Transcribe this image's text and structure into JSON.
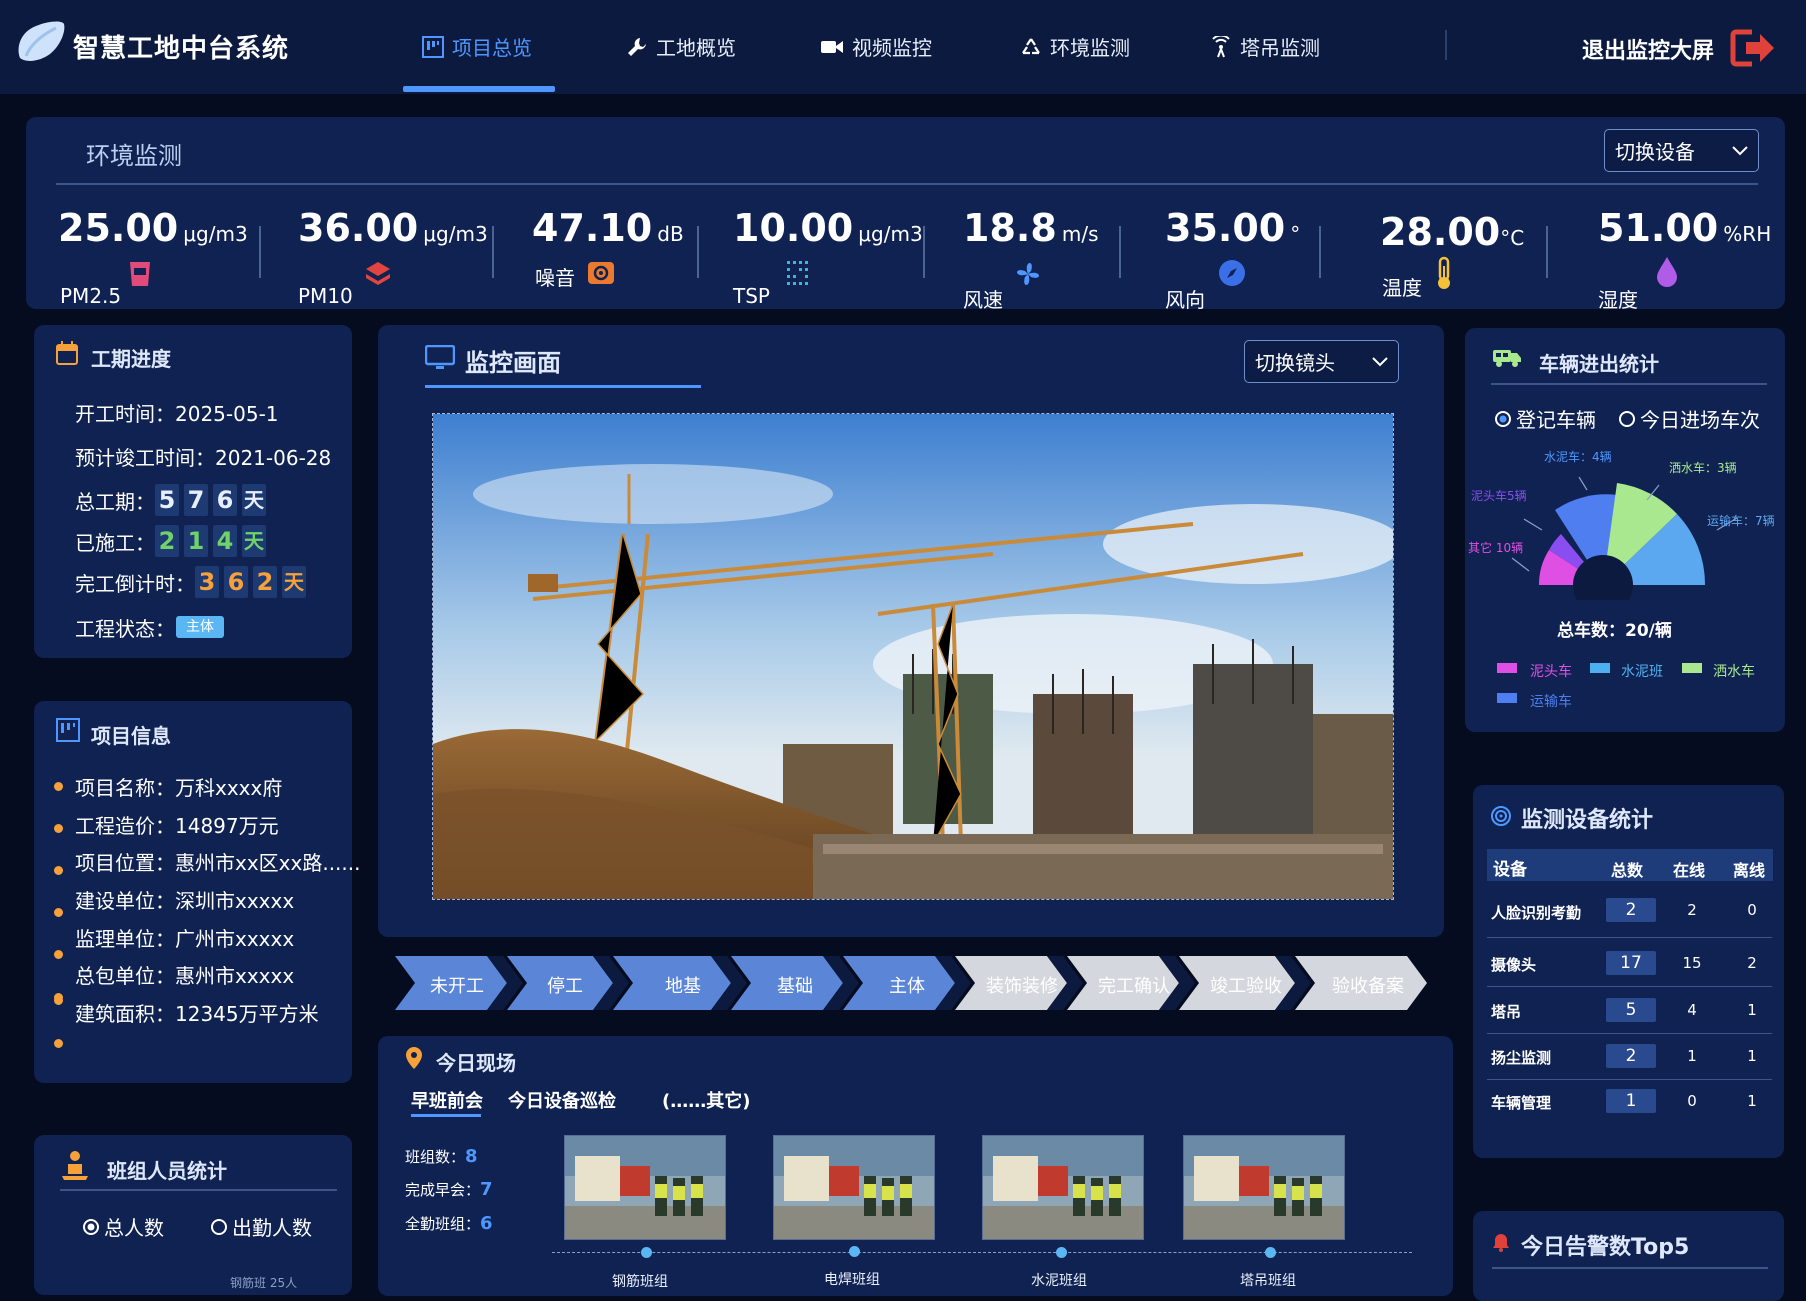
{
  "header": {
    "brand": "智慧工地中台系统",
    "nav": [
      {
        "label": "项目总览",
        "icon": "dashboard-icon",
        "active": true
      },
      {
        "label": "工地概览",
        "icon": "wrench-icon",
        "active": false
      },
      {
        "label": "视频监控",
        "icon": "video-camera-icon",
        "active": false
      },
      {
        "label": "环境监测",
        "icon": "recycle-icon",
        "active": false
      },
      {
        "label": "塔吊监测",
        "icon": "signal-icon",
        "active": false
      }
    ],
    "exit_label": "退出监控大屏",
    "accent": "#4f97ff",
    "exit_color": "#e0413a"
  },
  "environment": {
    "title": "环境监测",
    "switch_label": "切换设备",
    "metrics": [
      {
        "value": "25.00",
        "unit": "μg/m3",
        "label": "PM2.5",
        "icon": "cup-icon"
      },
      {
        "value": "36.00",
        "unit": "μg/m3",
        "label": "PM10",
        "icon": "layers-icon"
      },
      {
        "value": "47.10",
        "unit": "dB",
        "label": "噪音",
        "icon": "speaker-icon"
      },
      {
        "value": "10.00",
        "unit": "μg/m3",
        "label": "TSP",
        "icon": "grid-icon"
      },
      {
        "value": "18.8",
        "unit": "m/s",
        "label": "风速",
        "icon": "fan-icon"
      },
      {
        "value": "35.00",
        "unit": "°",
        "label": "风向",
        "icon": "compass-icon"
      },
      {
        "value": "28.00",
        "unit": "°C",
        "label": "温度",
        "icon": "thermometer-icon"
      },
      {
        "value": "51.00",
        "unit": "%RH",
        "label": "湿度",
        "icon": "droplet-icon"
      }
    ]
  },
  "schedule": {
    "title": "工期进度",
    "start": "开工时间：2025-05-1",
    "planned_end": "预计竣工时间：2021-06-28",
    "total_label": "总工期：",
    "total_digits": [
      "5",
      "7",
      "6"
    ],
    "done_label": "已施工：",
    "done_digits": [
      "2",
      "1",
      "4"
    ],
    "countdown_label": "完工倒计时：",
    "countdown_digits": [
      "3",
      "6",
      "2"
    ],
    "day": "天",
    "status_label": "工程状态：",
    "status_value": "主体"
  },
  "project": {
    "title": "项目信息",
    "items": [
      "项目名称：万科xxxx府",
      "工程造价：14897万元",
      "项目位置：惠州市xx区xx路......",
      "建设单位：深圳市xxxxx",
      "监理单位：广州市xxxxx",
      "总包单位：惠州市xxxxx",
      "建筑面积：12345万平方米"
    ]
  },
  "team": {
    "title": "班组人员统计",
    "radio1": "总人数",
    "radio2": "出勤人数",
    "cut": "钢筋班 25人"
  },
  "monitor": {
    "title": "监控画面",
    "switch_label": "切换镜头"
  },
  "stages": [
    {
      "label": "未开工",
      "done": true
    },
    {
      "label": "停工",
      "done": true
    },
    {
      "label": "地基",
      "done": true
    },
    {
      "label": "基础",
      "done": true
    },
    {
      "label": "主体",
      "done": true
    },
    {
      "label": "装饰装修",
      "done": false
    },
    {
      "label": "完工确认",
      "done": false
    },
    {
      "label": "竣工验收",
      "done": false
    },
    {
      "label": "验收备案",
      "done": false
    }
  ],
  "today": {
    "title": "今日现场",
    "tabs": [
      "早班前会",
      "今日设备巡检",
      "(……其它)"
    ],
    "stats": [
      {
        "label": "班组数：",
        "value": "8"
      },
      {
        "label": "完成早会：",
        "value": "7"
      },
      {
        "label": "全勤班组：",
        "value": "6"
      }
    ],
    "thumb_labels": [
      "钢筋班组",
      "电焊班组",
      "水泥班组",
      "塔吊班组"
    ]
  },
  "vehicles": {
    "title": "车辆进出统计",
    "radio1": "登记车辆",
    "radio2": "今日进场车次",
    "total": "总车数：20/辆",
    "slice_labels": [
      "水泥车：4辆",
      "洒水车：3辆",
      "泥头车5辆",
      "运输车：7辆",
      "其它 10辆"
    ],
    "legend": [
      "泥头车",
      "水泥班",
      "洒水车",
      "运输车"
    ],
    "colors": {
      "mud": "#e04fe4",
      "cement": "#4fb0f0",
      "sprinkler": "#a9e88f",
      "transport": "#4e7ef0",
      "purple": "#8a4ef0"
    }
  },
  "devices": {
    "title": "监测设备统计",
    "headers": [
      "设备",
      "总数",
      "在线",
      "离线"
    ],
    "rows": [
      [
        "人脸识别考勤",
        "2",
        "2",
        "0"
      ],
      [
        "摄像头",
        "17",
        "15",
        "2"
      ],
      [
        "塔吊",
        "5",
        "4",
        "1"
      ],
      [
        "扬尘监测",
        "2",
        "1",
        "1"
      ],
      [
        "车辆管理",
        "1",
        "0",
        "1"
      ]
    ]
  },
  "alarms": {
    "title": "今日告警数Top5"
  }
}
